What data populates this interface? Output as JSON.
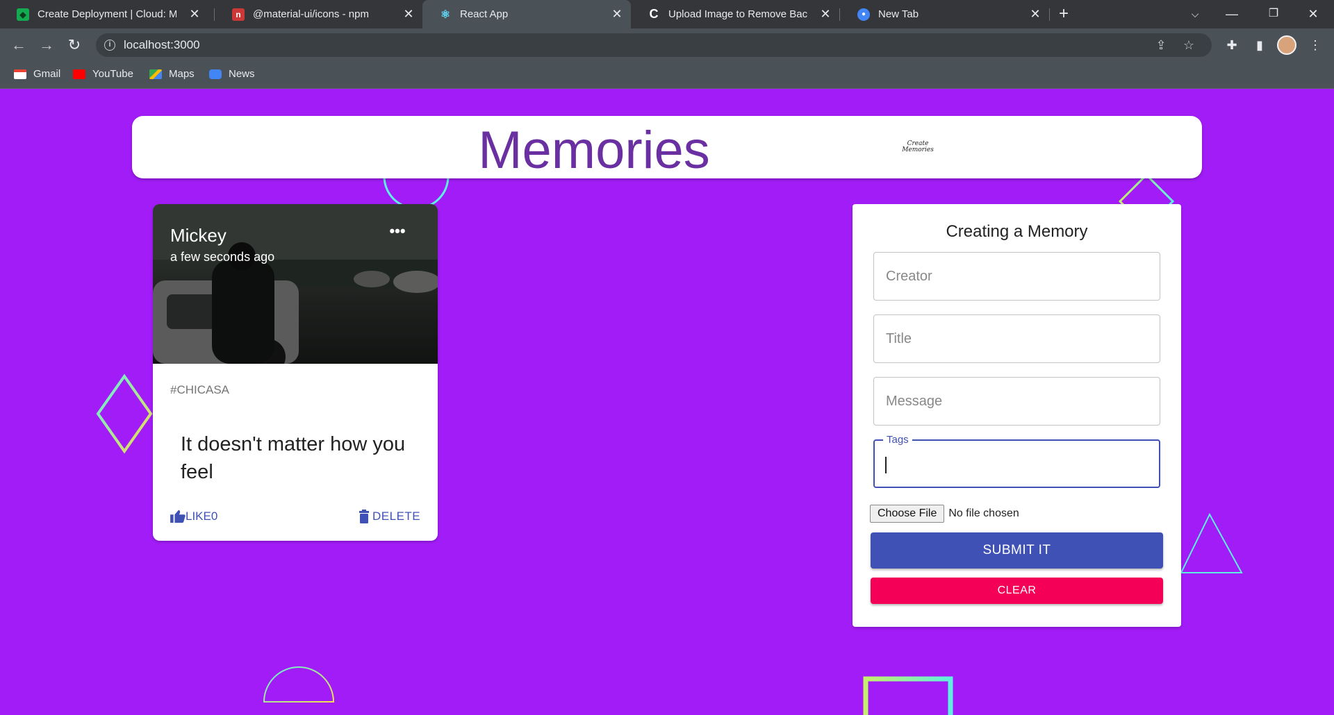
{
  "browser": {
    "tabs": [
      {
        "title": "Create Deployment | Cloud: Mon",
        "favicon_color": "#13aa52",
        "active": false
      },
      {
        "title": "@material-ui/icons - npm",
        "favicon_color": "#cb3837",
        "active": false
      },
      {
        "title": "React App",
        "favicon_color": "#61dafb",
        "active": true
      },
      {
        "title": "Upload Image to Remove Backgr",
        "favicon_color": "#ffffff",
        "active": false
      },
      {
        "title": "New Tab",
        "favicon_color": "#4285f4",
        "active": false
      }
    ],
    "url": "localhost:3000",
    "bookmarks": [
      {
        "label": "Gmail",
        "icon": "gmail-icon"
      },
      {
        "label": "YouTube",
        "icon": "youtube-icon"
      },
      {
        "label": "Maps",
        "icon": "maps-icon"
      },
      {
        "label": "News",
        "icon": "news-icon"
      }
    ]
  },
  "app": {
    "title": "Memories",
    "logo_text": "Create Memories"
  },
  "post": {
    "creator": "Mickey",
    "time": "a few seconds ago",
    "tags": "#CHICASA",
    "message": "It doesn't matter how you feel",
    "like_label": "LIKE0",
    "delete_label": "DELETE"
  },
  "form": {
    "title": "Creating a Memory",
    "creator_placeholder": "Creator",
    "title_placeholder": "Title",
    "message_placeholder": "Message",
    "tags_label": "Tags",
    "file_button": "Choose File",
    "file_status": "No file chosen",
    "submit_label": "SUBMIT IT",
    "clear_label": "CLEAR"
  },
  "colors": {
    "background": "#a21cf7",
    "title": "#6a2fa0",
    "primary": "#3f51b5",
    "secondary": "#f50057"
  }
}
